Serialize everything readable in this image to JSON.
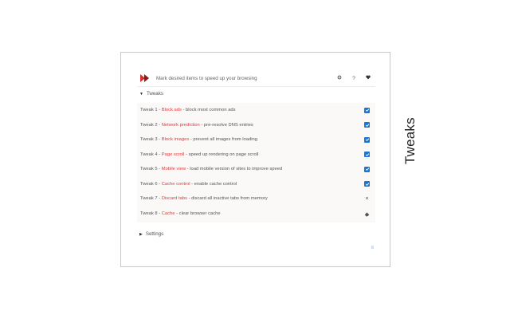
{
  "header": {
    "text": "Mark desired items to speed up your browsing",
    "icons": [
      "gear-icon",
      "help-icon",
      "heart-icon"
    ],
    "help_label": "?"
  },
  "sections": {
    "tweaks_label": "Tweaks",
    "settings_label": "Settings"
  },
  "tweaks": [
    {
      "prefix": "Tweak 1 - ",
      "name": "Block ads",
      "desc": " - block most common ads",
      "checked": true
    },
    {
      "prefix": "Tweak 2 - ",
      "name": "Network prediction",
      "desc": " - pre-resolve DNS entries",
      "checked": true
    },
    {
      "prefix": "Tweak 3 - ",
      "name": "Block images",
      "desc": " - prevent all images from loading",
      "checked": true
    },
    {
      "prefix": "Tweak 4 - ",
      "name": "Page scroll",
      "desc": " - speed up rendering on page scroll",
      "checked": true
    },
    {
      "prefix": "Tweak 5 - ",
      "name": "Mobile view",
      "desc": " - load mobile version of sites to improve speed",
      "checked": true
    },
    {
      "prefix": "Tweak 6 - ",
      "name": "Cache control",
      "desc": " - enable cache control",
      "checked": true
    },
    {
      "prefix": "Tweak 7 - ",
      "name": "Discard tabs",
      "desc": " - discard all inactive tabs from memory",
      "action": "close-icon",
      "action_glyph": "×"
    },
    {
      "prefix": "Tweak 8 - ",
      "name": "Cache",
      "desc": " - clear browser cache",
      "action": "eraser-icon"
    }
  ],
  "footer": {
    "icon": "list-icon",
    "glyph": "≡"
  },
  "side_title": "Tweaks",
  "colors": {
    "accent": "#e53935",
    "checkbox": "#1976d2",
    "list_bg": "#fbf8f8"
  }
}
